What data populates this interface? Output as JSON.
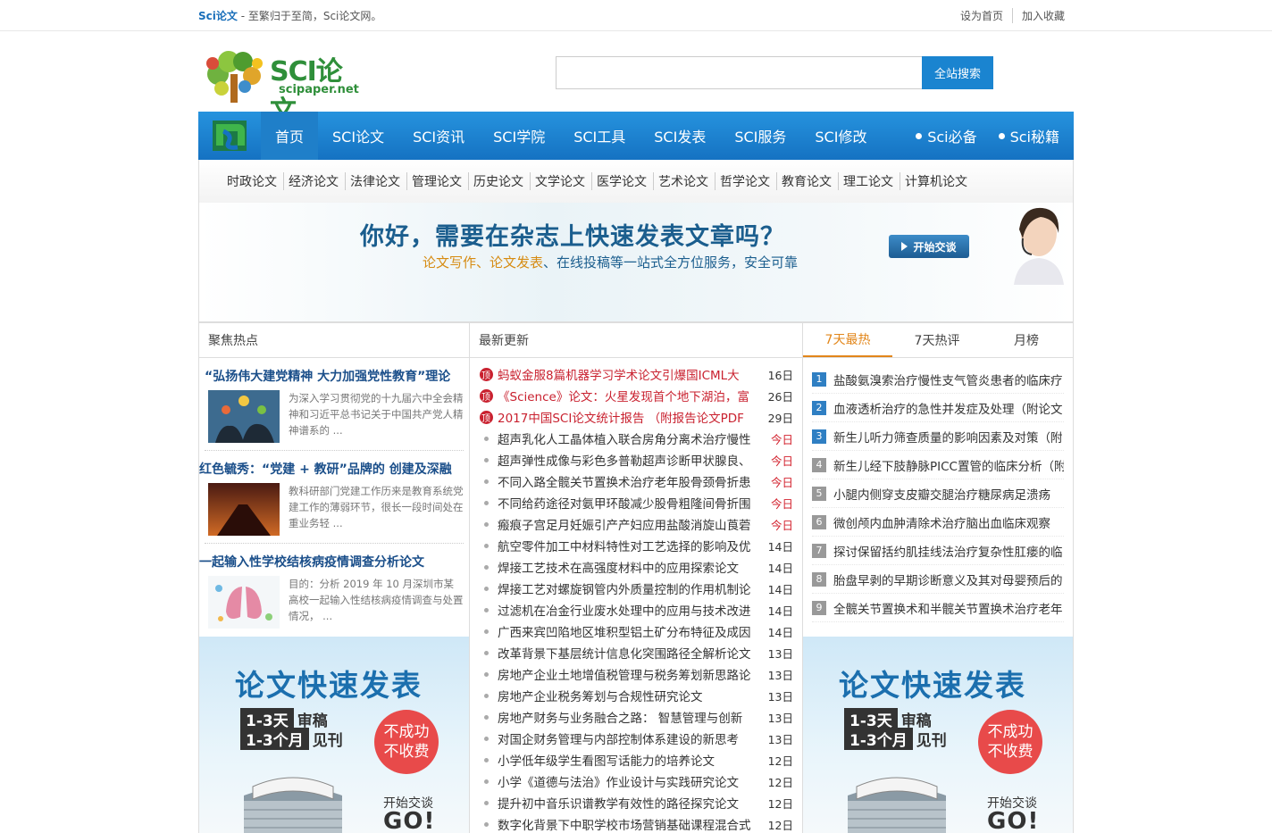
{
  "topbar": {
    "brand": "Sci论文",
    "slogan": " - 至繁归于至简，Sci论文网。",
    "links": [
      "设为首页",
      "加入收藏"
    ]
  },
  "logo": {
    "title": "SCI论文",
    "subtitle": "scipaper.net"
  },
  "search": {
    "placeholder": "",
    "button": "全站搜索"
  },
  "nav": {
    "items": [
      "首页",
      "SCI论文",
      "SCI资讯",
      "SCI学院",
      "SCI工具",
      "SCI发表",
      "SCI服务",
      "SCI修改"
    ],
    "right": [
      "Sci必备",
      "Sci秘籍"
    ]
  },
  "subnav": [
    "时政论文",
    "经济论文",
    "法律论文",
    "管理论文",
    "历史论文",
    "文学论文",
    "医学论文",
    "艺术论文",
    "哲学论文",
    "教育论文",
    "理工论文",
    "计算机论文"
  ],
  "banner": {
    "title": "你好，需要在杂志上快速发表文章吗？",
    "sub_hl1": "论文写作、",
    "sub_hl2": "论文发表",
    "sub_rest": "、在线投稿等一站式全方位服务，安全可靠",
    "button": "开始交谈"
  },
  "focus": {
    "heading": "聚焦热点",
    "items": [
      {
        "title": "“弘扬伟大建党精神 大力加强党性教育”理论",
        "desc": "为深入学习贯彻党的十九届六中全会精神和习近平总书记关于中国共产党人精神谱系的 ..."
      },
      {
        "title": "红色毓秀：“党建 + 教研”品牌的 创建及深融",
        "desc": "教科研部门党建工作历来是教育系统党建工作的薄弱环节，很长一段时间处在重业务轻 ..."
      },
      {
        "title": "一起输入性学校结核病疫情调查分析论文",
        "desc": "目的：分析 2019 年 10 月深圳市某高校一起输入性结核病疫情调查与处置情况，  ..."
      }
    ]
  },
  "ad": {
    "title": "论文快速发表",
    "row1_box": "1-3天",
    "row1_text": "审稿",
    "row2_box": "1-3个月",
    "row2_text": "见刊",
    "circle1": "不成功",
    "circle2": "不收费",
    "start": "开始交谈",
    "go": "GO!"
  },
  "latest": {
    "heading": "最新更新",
    "top_badge": "顶",
    "items": [
      {
        "title": "蚂蚁金服8篇机器学习学术论文引爆国ICML大",
        "date": "16日",
        "top": true
      },
      {
        "title": "《Science》论文：火星发现首个地下湖泊，富",
        "date": "26日",
        "top": true
      },
      {
        "title": "2017中国SCI论文统计报告 （附报告论文PDF",
        "date": "29日",
        "top": true
      },
      {
        "title": "超声乳化人工晶体植入联合房角分离术治疗慢性",
        "date": "今日",
        "today": true
      },
      {
        "title": "超声弹性成像与彩色多普勒超声诊断甲状腺良、",
        "date": "今日",
        "today": true
      },
      {
        "title": "不同入路全髋关节置换术治疗老年股骨颈骨折患",
        "date": "今日",
        "today": true
      },
      {
        "title": "不同给药途径对氨甲环酸减少股骨粗隆间骨折围",
        "date": "今日",
        "today": true
      },
      {
        "title": "瘢痕子宫足月妊娠引产产妇应用盐酸消旋山莨菪",
        "date": "今日",
        "today": true
      },
      {
        "title": "航空零件加工中材料特性对工艺选择的影响及优",
        "date": "14日"
      },
      {
        "title": "焊接工艺技术在高强度材料中的应用探索论文",
        "date": "14日"
      },
      {
        "title": "焊接工艺对螺旋钢管内外质量控制的作用机制论",
        "date": "14日"
      },
      {
        "title": "过滤机在冶金行业废水处理中的应用与技术改进",
        "date": "14日"
      },
      {
        "title": "广西来宾凹陷地区堆积型铝土矿分布特征及成因",
        "date": "14日"
      },
      {
        "title": "改革背景下基层统计信息化突围路径全解析论文",
        "date": "13日"
      },
      {
        "title": "房地产企业土地增值税管理与税务筹划新思路论",
        "date": "13日"
      },
      {
        "title": "房地产企业税务筹划与合规性研究论文",
        "date": "13日"
      },
      {
        "title": "房地产财务与业务融合之路： 智慧管理与创新",
        "date": "13日"
      },
      {
        "title": "对国企财务管理与内部控制体系建设的新思考",
        "date": "13日"
      },
      {
        "title": "小学低年级学生看图写话能力的培养论文",
        "date": "12日"
      },
      {
        "title": "小学《道德与法治》作业设计与实践研究论文",
        "date": "12日"
      },
      {
        "title": "提升初中音乐识谱教学有效性的路径探究论文",
        "date": "12日"
      },
      {
        "title": "数字化背景下中职学校市场营销基础课程混合式",
        "date": "12日"
      }
    ]
  },
  "rank": {
    "tabs": [
      "7天最热",
      "7天热评",
      "月榜"
    ],
    "items": [
      "盐酸氨溴索治疗慢性支气管炎患者的临床疗",
      "血液透析治疗的急性并发症及处理（附论文",
      "新生儿听力筛查质量的影响因素及对策（附",
      "新生儿经下肢静脉PICC置管的临床分析（附",
      "小腿内侧穿支皮瓣交腿治疗糖尿病足溃疡",
      "微创颅内血肿清除术治疗脑出血临床观察",
      "探讨保留括约肌挂线法治疗复杂性肛瘘的临",
      "胎盘早剥的早期诊断意义及其对母婴预后的",
      "全髋关节置换术和半髋关节置换术治疗老年"
    ],
    "numbers": [
      "1",
      "2",
      "3",
      "4",
      "5",
      "6",
      "7",
      "8",
      "9"
    ]
  },
  "colors": {
    "accent": "#1a84d0",
    "top_red": "#c9212f",
    "tab_orange": "#e2861a",
    "brand_green": "#2f8f3a"
  }
}
